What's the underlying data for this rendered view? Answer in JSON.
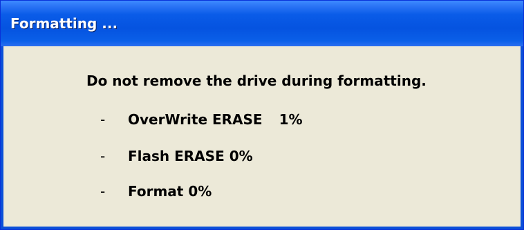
{
  "window": {
    "title": "Formatting ..."
  },
  "dialog": {
    "message": "Do not remove the drive during formatting.",
    "steps": [
      {
        "dash": "-",
        "label": "OverWrite ERASE",
        "percent": "1%"
      },
      {
        "dash": "-",
        "label": "Flash ERASE 0%"
      },
      {
        "dash": "-",
        "label": "Format 0%"
      }
    ]
  },
  "colors": {
    "titlebar_blue": "#0553e0",
    "client_background": "#ece9d8",
    "title_text": "#ffffff"
  }
}
